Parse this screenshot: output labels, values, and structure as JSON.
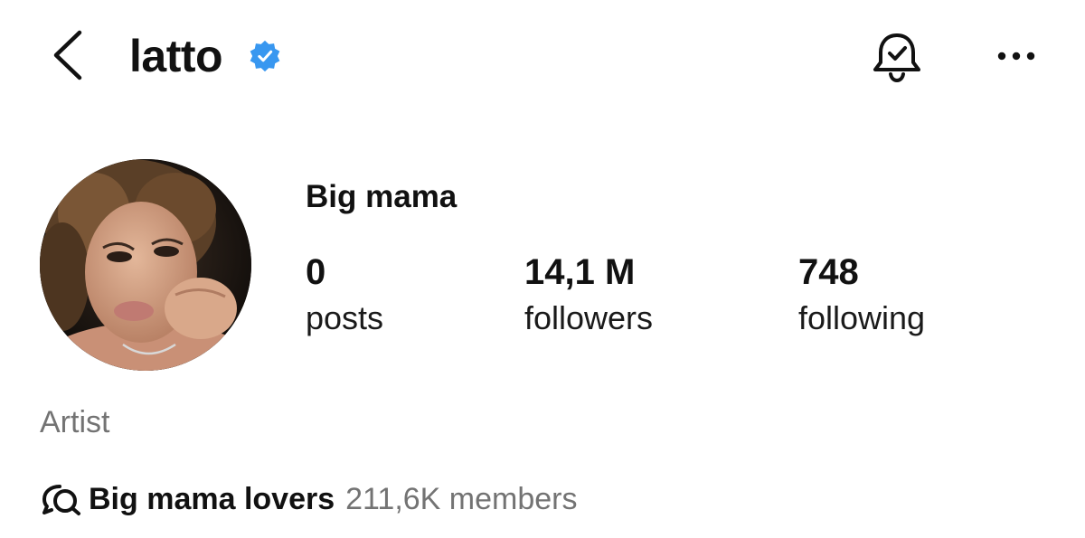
{
  "header": {
    "username": "latto",
    "icons": {
      "back": "chevron-left-icon",
      "verified": "verified-badge-icon",
      "notifications": "bell-check-icon",
      "more": "more-horizontal-icon"
    },
    "colors": {
      "verified": "#3897f0"
    }
  },
  "profile": {
    "display_name": "Big mama",
    "stats": [
      {
        "value": "0",
        "label": "posts"
      },
      {
        "value": "14,1 M",
        "label": "followers"
      },
      {
        "value": "748",
        "label": "following"
      }
    ],
    "category": "Artist",
    "channel": {
      "icon": "broadcast-chat-icon",
      "name": "Big mama lovers",
      "members": "211,6K members"
    }
  }
}
